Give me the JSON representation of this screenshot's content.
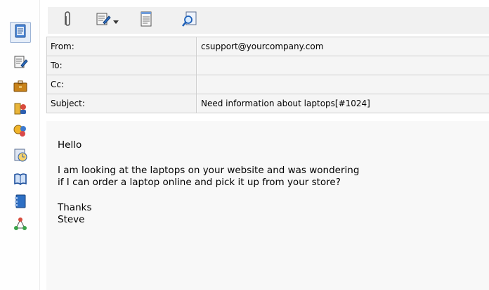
{
  "sidebar": {
    "items": [
      {
        "name": "mail-message-icon"
      },
      {
        "name": "compose-note-icon"
      },
      {
        "name": "briefcase-icon"
      },
      {
        "name": "contacts-icon"
      },
      {
        "name": "users-group-icon"
      },
      {
        "name": "calendar-clock-icon"
      },
      {
        "name": "knowledge-book-icon"
      },
      {
        "name": "address-book-icon"
      },
      {
        "name": "workflow-network-icon"
      }
    ]
  },
  "toolbar": {
    "items": [
      {
        "name": "attachment-icon"
      },
      {
        "name": "edit-note-dropdown-icon"
      },
      {
        "name": "document-icon"
      },
      {
        "name": "search-document-icon"
      }
    ]
  },
  "header": {
    "from_label": "From:",
    "from_value": "csupport@yourcompany.com",
    "to_label": "To:",
    "to_value": "",
    "cc_label": "Cc:",
    "cc_value": "",
    "subject_label": "Subject:",
    "subject_value": "Need information about laptops[#1024]"
  },
  "body": {
    "greeting": "Hello",
    "line1": "I am looking at the laptops on your website and was wondering",
    "line2": "if I can order a laptop online and pick it up from your store?",
    "closing": "Thanks",
    "signature": "Steve"
  }
}
